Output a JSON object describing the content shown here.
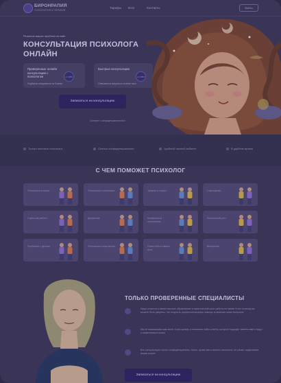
{
  "header": {
    "logo_title": "БИРОНРАПИЯ",
    "logo_subtitle": "ПСИХОЛОГИЯ И ТЕРАПИЯ",
    "nav": [
      "Тарифы",
      "Блог",
      "Контакты"
    ],
    "login": "Войти"
  },
  "hero": {
    "eyebrow": "Решение ваших проблем онлайн",
    "title": "КОНСУЛЬТАЦИЯ ПСИХОЛОГА ОНЛАЙН",
    "cards": [
      {
        "text": "Проверенные онлайн консультации с психологом",
        "sub": "Подберем специалиста за 5 минут",
        "badge": "от 1000"
      },
      {
        "text": "Быстрые консультации",
        "sub": "Отвечаем на вопросы в течение часа",
        "badge": "от 1000"
      }
    ],
    "cta": "Записаться на консультацию",
    "privacy": "Согласие с конфиденциальностью"
  },
  "features": [
    "Только опытные психологи",
    "Сеансы конфиденциальные",
    "Удобный личный кабинет",
    "В удобное время"
  ],
  "help": {
    "title": "С ЧЕМ ПОМОЖЕТ ПСИХОЛОГ",
    "tiles": [
      "Отношения в семье",
      "Отношения с коллегами",
      "Тревога и страхи",
      "Самооценка",
      "Стресс на работе",
      "Депрессия",
      "Конфликты в отношениях",
      "Личностный рост",
      "Проблемы с детьми",
      "Отношения с партнером",
      "Поиск себя и своего пути",
      "Выгорание"
    ]
  },
  "specialists": {
    "title": "ТОЛЬКО ПРОВЕРЕННЫЕ СПЕЦИАЛИСТЫ",
    "rows": [
      "Наши психологи имеют высшее образование и практический опыт работы не менее 5 лет, поэтому вы можете быть уверены, что получите профессиональную помощь в решении своих вопросов",
      "Мы не навязываем вам своих точек зрения, а помогаем найти ответы, которые подходят именно вам и ведут к изменениям в жизни",
      "Все консультации строго конфиденциальны. Никто, кроме вас и вашего психолога, не узнает содержание ваших встреч"
    ],
    "cta": "Записаться на консультацию"
  },
  "colors": {
    "accent": "#2c235f",
    "hair": "#7a4a3a",
    "overlay": "#3a3456"
  }
}
